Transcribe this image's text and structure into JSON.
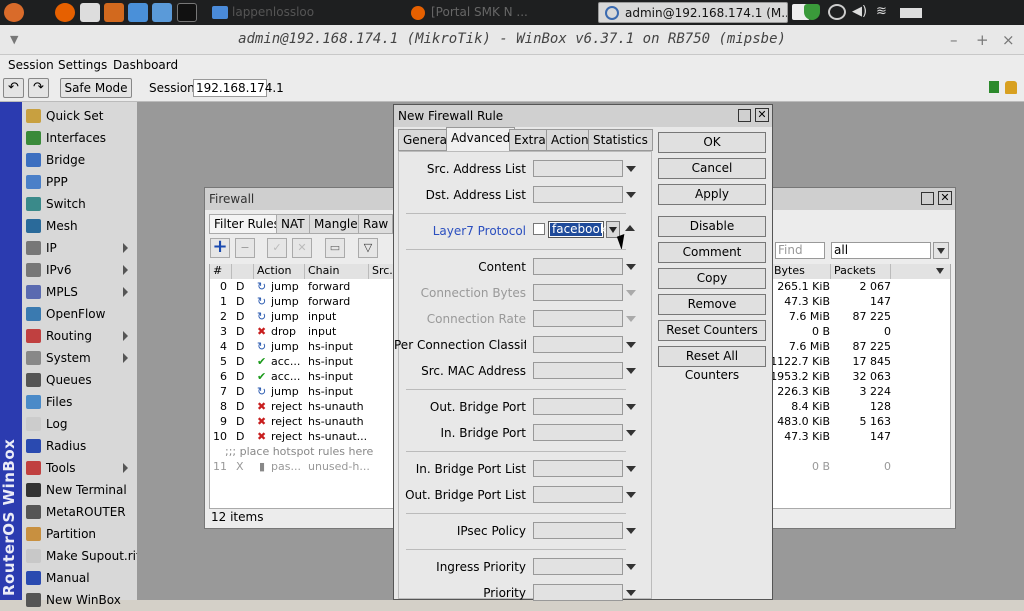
{
  "taskbar": {
    "tasks": [
      "[Portal SMK N ...",
      "admin@192.168.174.1 (M..."
    ],
    "partial_task": "lappenlossloo"
  },
  "window": {
    "title": "admin@192.168.174.1 (MikroTik) - WinBox v6.37.1 on RB750 (mipsbe)",
    "controls": [
      "–",
      "+",
      "×"
    ]
  },
  "menubar": [
    "Session",
    "Settings",
    "Dashboard"
  ],
  "toolbar": {
    "safe_mode": "Safe Mode",
    "session_label": "Session:",
    "session_value": "192.168.174.1"
  },
  "sidebar": {
    "brand": "RouterOS WinBox",
    "items": [
      {
        "label": "Quick Set",
        "icon": "quickset-icon",
        "color": "#c8a040",
        "sub": false
      },
      {
        "label": "Interfaces",
        "icon": "interfaces-icon",
        "color": "#3a8a3a",
        "sub": false
      },
      {
        "label": "Bridge",
        "icon": "bridge-icon",
        "color": "#3c6fc0",
        "sub": false
      },
      {
        "label": "PPP",
        "icon": "ppp-icon",
        "color": "#4a7fc8",
        "sub": false
      },
      {
        "label": "Switch",
        "icon": "switch-icon",
        "color": "#3a8a8a",
        "sub": false
      },
      {
        "label": "Mesh",
        "icon": "mesh-icon",
        "color": "#2a6a9a",
        "sub": false
      },
      {
        "label": "IP",
        "icon": "ip-icon",
        "color": "#777777",
        "sub": true
      },
      {
        "label": "IPv6",
        "icon": "ipv6-icon",
        "color": "#777777",
        "sub": true
      },
      {
        "label": "MPLS",
        "icon": "mpls-icon",
        "color": "#5a6ab0",
        "sub": true
      },
      {
        "label": "OpenFlow",
        "icon": "openflow-icon",
        "color": "#3a7ab0",
        "sub": false
      },
      {
        "label": "Routing",
        "icon": "routing-icon",
        "color": "#c04040",
        "sub": true
      },
      {
        "label": "System",
        "icon": "system-icon",
        "color": "#888888",
        "sub": true
      },
      {
        "label": "Queues",
        "icon": "queues-icon",
        "color": "#555555",
        "sub": false
      },
      {
        "label": "Files",
        "icon": "files-icon",
        "color": "#4a8ac8",
        "sub": false
      },
      {
        "label": "Log",
        "icon": "log-icon",
        "color": "#cccccc",
        "sub": false
      },
      {
        "label": "Radius",
        "icon": "radius-icon",
        "color": "#2a4ab0",
        "sub": false
      },
      {
        "label": "Tools",
        "icon": "tools-icon",
        "color": "#c04040",
        "sub": true
      },
      {
        "label": "New Terminal",
        "icon": "terminal-icon",
        "color": "#333333",
        "sub": false
      },
      {
        "label": "MetaROUTER",
        "icon": "metarouter-icon",
        "color": "#555555",
        "sub": false
      },
      {
        "label": "Partition",
        "icon": "partition-icon",
        "color": "#c89040",
        "sub": false
      },
      {
        "label": "Make Supout.rif",
        "icon": "supout-icon",
        "color": "#c8c8c8",
        "sub": false
      },
      {
        "label": "Manual",
        "icon": "manual-icon",
        "color": "#2a4ab0",
        "sub": false
      },
      {
        "label": "New WinBox",
        "icon": "winbox-icon",
        "color": "#555555",
        "sub": false
      }
    ]
  },
  "firewall": {
    "title": "Firewall",
    "tabs": [
      "Filter Rules",
      "NAT",
      "Mangle",
      "Raw"
    ],
    "find_placeholder": "Find",
    "filter_value": "all",
    "columns": [
      "#",
      "",
      "Action",
      "Chain",
      "Src.",
      "Bytes",
      "Packets"
    ],
    "rows": [
      {
        "n": "0",
        "flag": "D",
        "action": "jump",
        "icon": "jump-icon",
        "chain": "forward",
        "bytes": "265.1 KiB",
        "packets": "2 067"
      },
      {
        "n": "1",
        "flag": "D",
        "action": "jump",
        "icon": "jump-icon",
        "chain": "forward",
        "bytes": "47.3 KiB",
        "packets": "147"
      },
      {
        "n": "2",
        "flag": "D",
        "action": "jump",
        "icon": "jump-icon",
        "chain": "input",
        "bytes": "7.6 MiB",
        "packets": "87 225"
      },
      {
        "n": "3",
        "flag": "D",
        "action": "drop",
        "icon": "drop-icon",
        "chain": "input",
        "bytes": "0 B",
        "packets": "0"
      },
      {
        "n": "4",
        "flag": "D",
        "action": "jump",
        "icon": "jump-icon",
        "chain": "hs-input",
        "bytes": "7.6 MiB",
        "packets": "87 225"
      },
      {
        "n": "5",
        "flag": "D",
        "action": "acc...",
        "icon": "accept-icon",
        "chain": "hs-input",
        "bytes": "1122.7 KiB",
        "packets": "17 845"
      },
      {
        "n": "6",
        "flag": "D",
        "action": "acc...",
        "icon": "accept-icon",
        "chain": "hs-input",
        "bytes": "1953.2 KiB",
        "packets": "32 063"
      },
      {
        "n": "7",
        "flag": "D",
        "action": "jump",
        "icon": "jump-icon",
        "chain": "hs-input",
        "bytes": "226.3 KiB",
        "packets": "3 224"
      },
      {
        "n": "8",
        "flag": "D",
        "action": "reject",
        "icon": "reject-icon",
        "chain": "hs-unauth",
        "bytes": "8.4 KiB",
        "packets": "128"
      },
      {
        "n": "9",
        "flag": "D",
        "action": "reject",
        "icon": "reject-icon",
        "chain": "hs-unauth",
        "bytes": "483.0 KiB",
        "packets": "5 163"
      },
      {
        "n": "10",
        "flag": "D",
        "action": "reject",
        "icon": "reject-icon",
        "chain": "hs-unaut...",
        "bytes": "47.3 KiB",
        "packets": "147"
      }
    ],
    "comment_row": ";;; place hotspot rules here",
    "disabled_row": {
      "n": "11",
      "flag": "X",
      "action": "pas...",
      "chain": "unused-h...",
      "bytes": "0 B",
      "packets": "0"
    },
    "status": "12 items"
  },
  "dialog": {
    "title": "New Firewall Rule",
    "tabs": [
      "General",
      "Advanced",
      "Extra",
      "Action",
      "Statistics"
    ],
    "active_tab": "Advanced",
    "fields": {
      "src_address_list": "Src. Address List",
      "dst_address_list": "Dst. Address List",
      "layer7_protocol": "Layer7 Protocol",
      "layer7_value": "facebook",
      "content": "Content",
      "connection_bytes": "Connection Bytes",
      "connection_rate": "Connection Rate",
      "per_connection_classifier": "Per Connection Classifier",
      "src_mac_address": "Src. MAC Address",
      "out_bridge_port": "Out. Bridge Port",
      "in_bridge_port": "In. Bridge Port",
      "in_bridge_port_list": "In. Bridge Port List",
      "out_bridge_port_list": "Out. Bridge Port List",
      "ipsec_policy": "IPsec Policy",
      "ingress_priority": "Ingress Priority",
      "priority": "Priority"
    },
    "buttons": [
      "OK",
      "Cancel",
      "Apply",
      "Disable",
      "Comment",
      "Copy",
      "Remove",
      "Reset Counters",
      "Reset All Counters"
    ]
  }
}
